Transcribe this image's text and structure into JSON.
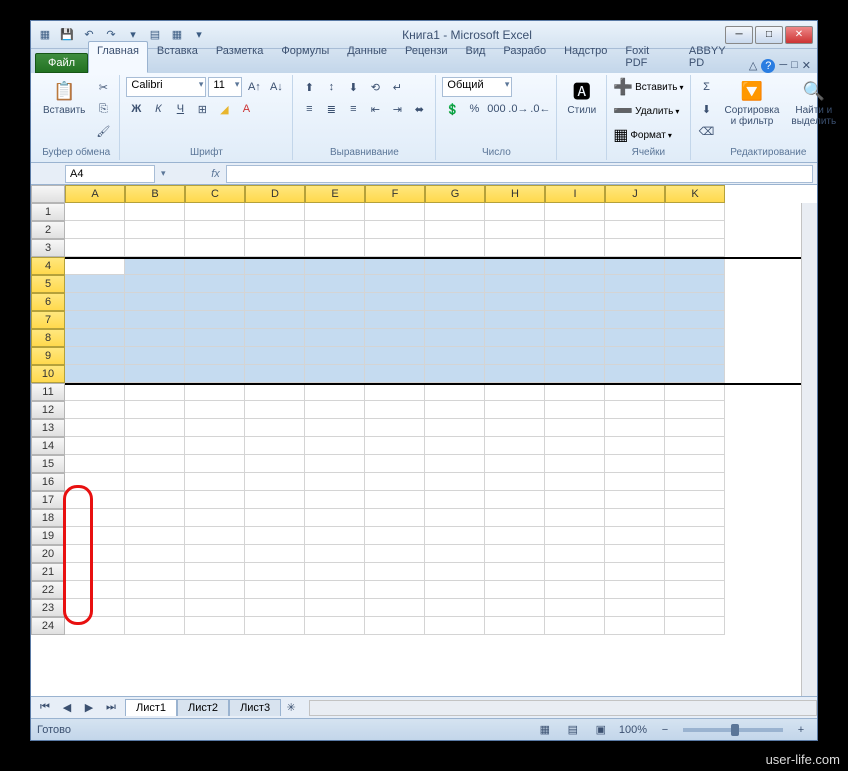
{
  "title": "Книга1 - Microsoft Excel",
  "file_tab": "Файл",
  "tabs": [
    "Главная",
    "Вставка",
    "Разметка",
    "Формулы",
    "Данные",
    "Рецензи",
    "Вид",
    "Разрабо",
    "Надстро",
    "Foxit PDF",
    "ABBYY PD"
  ],
  "active_tab": 0,
  "ribbon": {
    "clipboard": {
      "paste": "Вставить",
      "label": "Буфер обмена"
    },
    "font": {
      "name": "Calibri",
      "size": "11",
      "label": "Шрифт"
    },
    "alignment": {
      "label": "Выравнивание"
    },
    "number": {
      "format": "Общий",
      "label": "Число"
    },
    "styles": {
      "btn": "Стили",
      "label": ""
    },
    "cells": {
      "insert": "Вставить",
      "delete": "Удалить",
      "format": "Формат",
      "label": "Ячейки"
    },
    "editing": {
      "sort": "Сортировка\nи фильтр",
      "find": "Найти и\nвыделить",
      "label": "Редактирование"
    }
  },
  "namebox": "A4",
  "columns": [
    "A",
    "B",
    "C",
    "D",
    "E",
    "F",
    "G",
    "H",
    "I",
    "J",
    "K"
  ],
  "rows": [
    1,
    2,
    3,
    4,
    5,
    6,
    7,
    8,
    9,
    10,
    11,
    12,
    13,
    14,
    15,
    16,
    17,
    18,
    19,
    20,
    21,
    22,
    23,
    24
  ],
  "selected_rows": [
    4,
    5,
    6,
    7,
    8,
    9,
    10
  ],
  "active_cell_row": 4,
  "sheets": [
    "Лист1",
    "Лист2",
    "Лист3"
  ],
  "active_sheet": 0,
  "status": "Готово",
  "zoom": "100%",
  "watermark": "user-life.com"
}
